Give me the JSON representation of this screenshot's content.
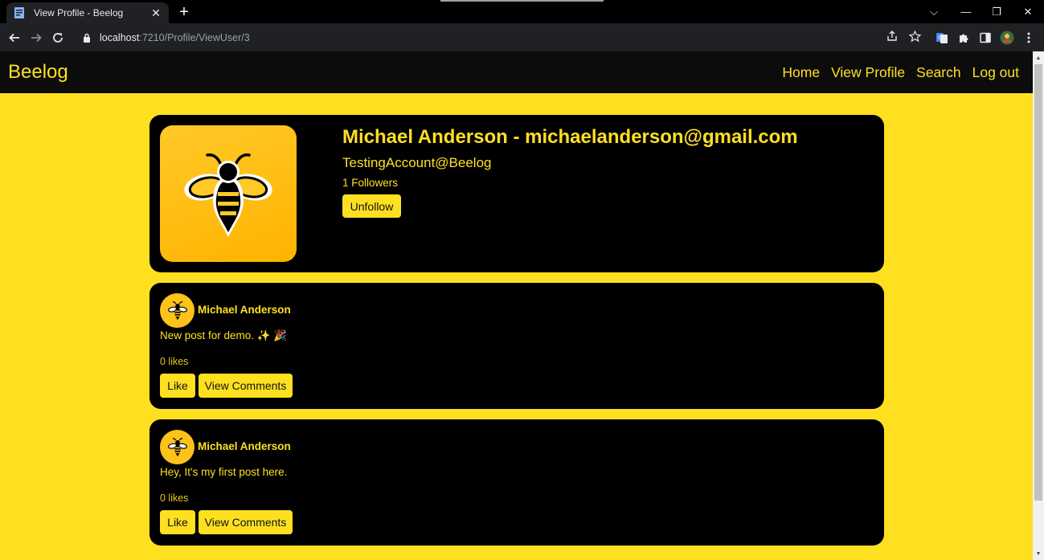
{
  "browser": {
    "tab_title": "View Profile - Beelog",
    "tab_close": "✕",
    "new_tab": "+",
    "url_host": "localhost",
    "url_path": ":7210/Profile/ViewUser/3",
    "window_controls": [
      "⌵",
      "—",
      "❐",
      "✕"
    ]
  },
  "nav": {
    "brand": "Beelog",
    "links": [
      "Home",
      "View Profile",
      "Search",
      "Log out"
    ]
  },
  "profile": {
    "name_email": "Michael Anderson - michaelanderson@gmail.com",
    "handle": "TestingAccount@Beelog",
    "followers": "1 Followers",
    "unfollow_label": "Unfollow"
  },
  "posts": [
    {
      "author": "Michael Anderson",
      "content": "New post for demo. ✨ 🎉",
      "likes": "0 likes",
      "like_label": "Like",
      "comments_label": "View Comments"
    },
    {
      "author": "Michael Anderson",
      "content": "Hey, It's my first post here.",
      "likes": "0 likes",
      "like_label": "Like",
      "comments_label": "View Comments"
    }
  ],
  "colors": {
    "accent": "#ffe021",
    "page_bg": "#ffe021",
    "card_bg": "#000000",
    "navbar_bg": "#0c0c0c"
  }
}
